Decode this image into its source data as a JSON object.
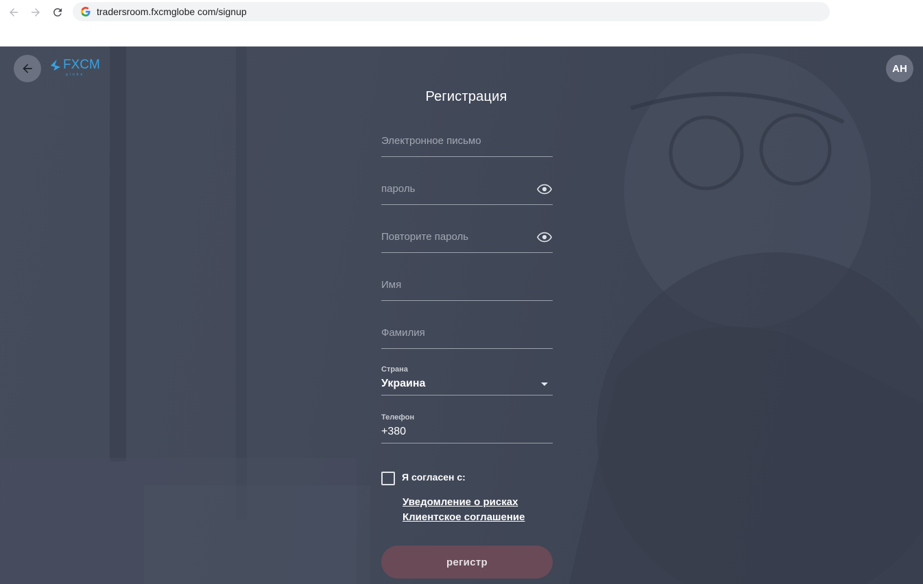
{
  "browser": {
    "url": "tradersroom.fxcmglobe com/signup"
  },
  "header": {
    "logo_text": "FXCM",
    "logo_sub": "globe",
    "avatar_initials": "AH"
  },
  "form": {
    "title": "Регистрация",
    "email_placeholder": "Электронное письмо",
    "password_placeholder": "пароль",
    "repeat_password_placeholder": "Повторите пароль",
    "first_name_placeholder": "Имя",
    "last_name_placeholder": "Фамилия",
    "country_label": "Страна",
    "country_value": "Украина",
    "phone_label": "Телефон",
    "phone_value": "+380",
    "agree_label": "Я согласен с:",
    "risk_link": "Уведомление о рисках",
    "agreement_link": "Клиентское соглашение",
    "submit_label": "регистр"
  },
  "colors": {
    "page_bg": "#434a5a",
    "submit_bg": "#6a4a57",
    "logo": "#3aa2e0"
  }
}
